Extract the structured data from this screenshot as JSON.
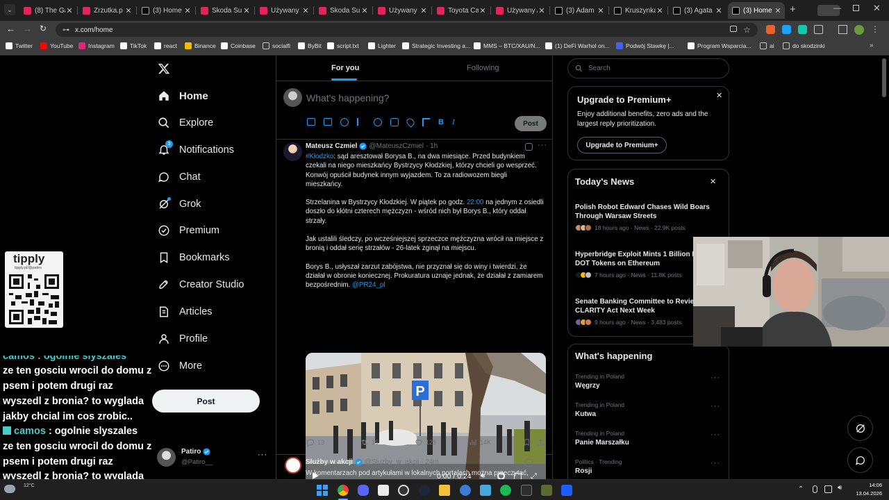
{
  "browser": {
    "tabs": [
      {
        "label": "(8) The Ga",
        "color": "#e0245e"
      },
      {
        "label": "Zrzutka.p",
        "color": "#e0245e"
      },
      {
        "label": "(3) Home /",
        "color": "#ffffff"
      },
      {
        "label": "Skoda Sup",
        "color": "#e0245e"
      },
      {
        "label": "Używany S",
        "color": "#e0245e"
      },
      {
        "label": "Skoda Sup",
        "color": "#e0245e"
      },
      {
        "label": "Używany S",
        "color": "#e0245e"
      },
      {
        "label": "Toyota Ca",
        "color": "#e0245e"
      },
      {
        "label": "Używany A",
        "color": "#e0245e"
      },
      {
        "label": "(3) Adam",
        "color": "#ffffff"
      },
      {
        "label": "Kruszynka",
        "color": "#ffffff"
      },
      {
        "label": "(3) Agata",
        "color": "#ffffff"
      },
      {
        "label": "(3) Home",
        "color": "#ffffff"
      }
    ],
    "url": "x.com/home",
    "bookmarks": [
      {
        "label": "Twitter",
        "color": "#ffffff"
      },
      {
        "label": "YouTube",
        "color": "#ff0000"
      },
      {
        "label": "Instagram",
        "color": "#d62976"
      },
      {
        "label": "TikTok",
        "color": "#ffffff"
      },
      {
        "label": "react",
        "color": "#ffffff"
      },
      {
        "label": "Binance",
        "color": "#f0b90b"
      },
      {
        "label": "Coinbase",
        "color": "#ffffff"
      },
      {
        "label": "socialfi",
        "color": "#c4c7c5"
      },
      {
        "label": "ByBit",
        "color": "#ffffff"
      },
      {
        "label": "script.txt",
        "color": "#ffffff"
      },
      {
        "label": "Lighter",
        "color": "#ffffff"
      },
      {
        "label": "Strategic Investing a...",
        "color": "#ffffff"
      },
      {
        "label": "MMS – BTC/XAU/N...",
        "color": "#ffffff"
      },
      {
        "label": "(1) DeFi Warhol on...",
        "color": "#ffffff"
      },
      {
        "label": "Podwój Stawkę |...",
        "color": "#4263eb"
      },
      {
        "label": "Program Wsparcia...",
        "color": "#ffffff"
      },
      {
        "label": "ai",
        "color": "#c4c7c5"
      },
      {
        "label": "do skodzinki",
        "color": "#c4c7c5"
      }
    ]
  },
  "nav": {
    "items": [
      "Home",
      "Explore",
      "Notifications",
      "Chat",
      "Grok",
      "Premium",
      "Bookmarks",
      "Creator Studio",
      "Articles",
      "Profile",
      "More"
    ],
    "notification_count": "3",
    "post_label": "Post",
    "account": {
      "name": "Patiro",
      "handle": "@Patiro__"
    }
  },
  "timeline": {
    "tabs": [
      "For you",
      "Following"
    ],
    "composer_placeholder": "What's happening?",
    "composer_post": "Post",
    "tweet1": {
      "name": "Mateusz Czmiel",
      "handle": "@MateuszCzmiel",
      "time": "· 1h",
      "hashtag": "#Kłodzko",
      "p1_rest": ": sąd aresztował Borysa B., na dwa miesiące. Przed budynkiem czekali na niego mieszkańcy Bystrzycy Kłodzkiej, którzy chcieli go wesprzeć. Konwój opuścił budynek innym wyjazdem. To za radiowozem biegli mieszkańcy.",
      "p2_a": "Strzelanina w Bystrzycy Kłodzkiej. W piątek po godz. ",
      "p2_time": "22:00",
      "p2_b": " na jednym z osiedli doszło do kłótni czterech mężczyzn - wśród nich był Borys B., który oddał strzały.",
      "p3": "Jak ustalili śledczy, po wcześniejszej sprzeczce mężczyzna wrócił na miejsce z bronią i oddał serię strzałów - 26-latek zginął na miejscu.",
      "p4": "Borys B., usłyszał zarzut zabójstwa, nie przyznał się do winy i twierdzi, że działał w obronie koniecznej. Prokuratura uznaje jednak, że działał z zamiarem bezpośrednim. ",
      "p4_mention": "@PR24_pl",
      "video_time": "0:00 / 0:24",
      "replies": "13",
      "reposts": "15",
      "likes": "128",
      "views": "14K"
    },
    "tweet2": {
      "name": "Służby w akcji",
      "handle": "@Sluzby_w_akcji",
      "time": "· 24m",
      "text": "W komentarzach pod artykułami w lokalnych portalach można przeczytać,"
    }
  },
  "sidebar": {
    "search_placeholder": "Search",
    "premium": {
      "title": "Upgrade to Premium+",
      "body": "Enjoy additional benefits, zero ads and the largest reply prioritization.",
      "button": "Upgrade to Premium+"
    },
    "news": {
      "title": "Today's News",
      "items": [
        {
          "headline": "Polish Robot Edward Chases Wild Boars Through Warsaw Streets",
          "meta": "18 hours ago · News · 22.9K posts"
        },
        {
          "headline": "Hyperbridge Exploit Mints 1 Billion Fake DOT Tokens on Ethereum",
          "meta": "7 hours ago · News · 11.8K posts"
        },
        {
          "headline": "Senate Banking Committee to Review CLARITY Act Next Week",
          "meta": "9 hours ago · News · 3,483 posts"
        }
      ]
    },
    "happening": {
      "title": "What's happening",
      "items": [
        {
          "context": "Trending in Poland",
          "name": "Węgrzy"
        },
        {
          "context": "Trending in Poland",
          "name": "Kutwa"
        },
        {
          "context": "Trending in Poland",
          "name": "Panie Marszałku"
        },
        {
          "context": "Politics · Trending",
          "name": "Rosji"
        }
      ]
    }
  },
  "overlay": {
    "tipply_label": "tipply",
    "tipply_url": "tipply.pl/@patiro",
    "chat_user": "camos",
    "chat_text_lines": [
      ": ogolnie slyszales",
      "ze ten gosciu wrocil do domu z",
      "psem i potem drugi raz",
      "wyszedl z bronia? to wyglada",
      "jakby chcial im cos zrobic.."
    ],
    "chat_top_lines": [
      "camos : ogolnie slyszales",
      "ze ten gosciu wrocil do domu z",
      "psem i potem drugi raz",
      "wyszedl z bronia? to wyglada",
      "jakby chcial im cos zrobic.."
    ]
  },
  "taskbar": {
    "weather": "12°C",
    "time": "14:06",
    "date": "13.04.2026"
  }
}
